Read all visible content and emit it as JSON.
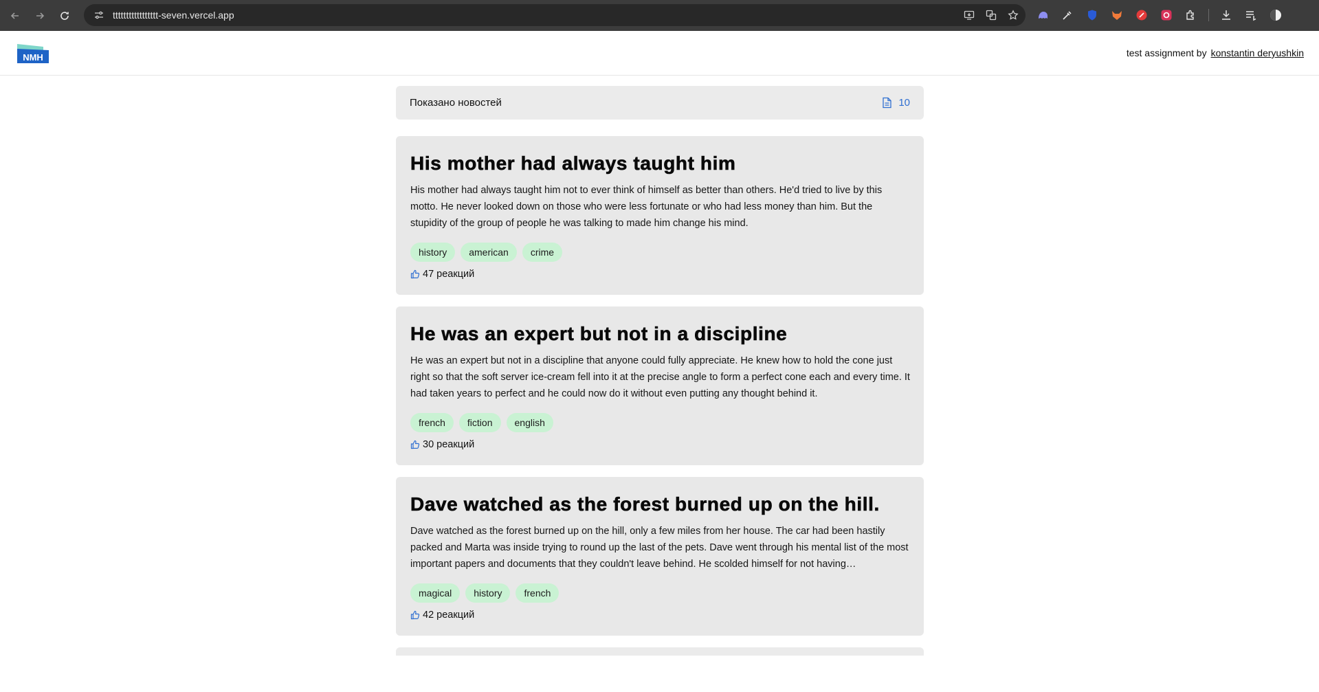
{
  "browser": {
    "url": "ttttttttttttttttt-seven.vercel.app"
  },
  "header": {
    "logo_text": "NMH",
    "credit_prefix": "test assignment by",
    "credit_link": "konstantin deryushkin"
  },
  "summary": {
    "label": "Показано новостей",
    "count": "10"
  },
  "posts": [
    {
      "title": "His mother had always taught him",
      "body": "His mother had always taught him not to ever think of himself as better than others. He'd tried to live by this motto. He never looked down on those who were less fortunate or who had less money than him. But the stupidity of the group of people he was talking to made him change his mind.",
      "tags": [
        "history",
        "american",
        "crime"
      ],
      "reactions": "47 реакций"
    },
    {
      "title": "He was an expert but not in a discipline",
      "body": "He was an expert but not in a discipline that anyone could fully appreciate. He knew how to hold the cone just right so that the soft server ice-cream fell into it at the precise angle to form a perfect cone each and every time. It had taken years to perfect and he could now do it without even putting any thought behind it.",
      "tags": [
        "french",
        "fiction",
        "english"
      ],
      "reactions": "30 реакций"
    },
    {
      "title": "Dave watched as the forest burned up on the hill.",
      "body": "Dave watched as the forest burned up on the hill, only a few miles from her house. The car had been hastily packed and Marta was inside trying to round up the last of the pets. Dave went through his mental list of the most important papers and documents that they couldn't leave behind. He scolded himself for not having…",
      "tags": [
        "magical",
        "history",
        "french"
      ],
      "reactions": "42 реакций"
    }
  ]
}
